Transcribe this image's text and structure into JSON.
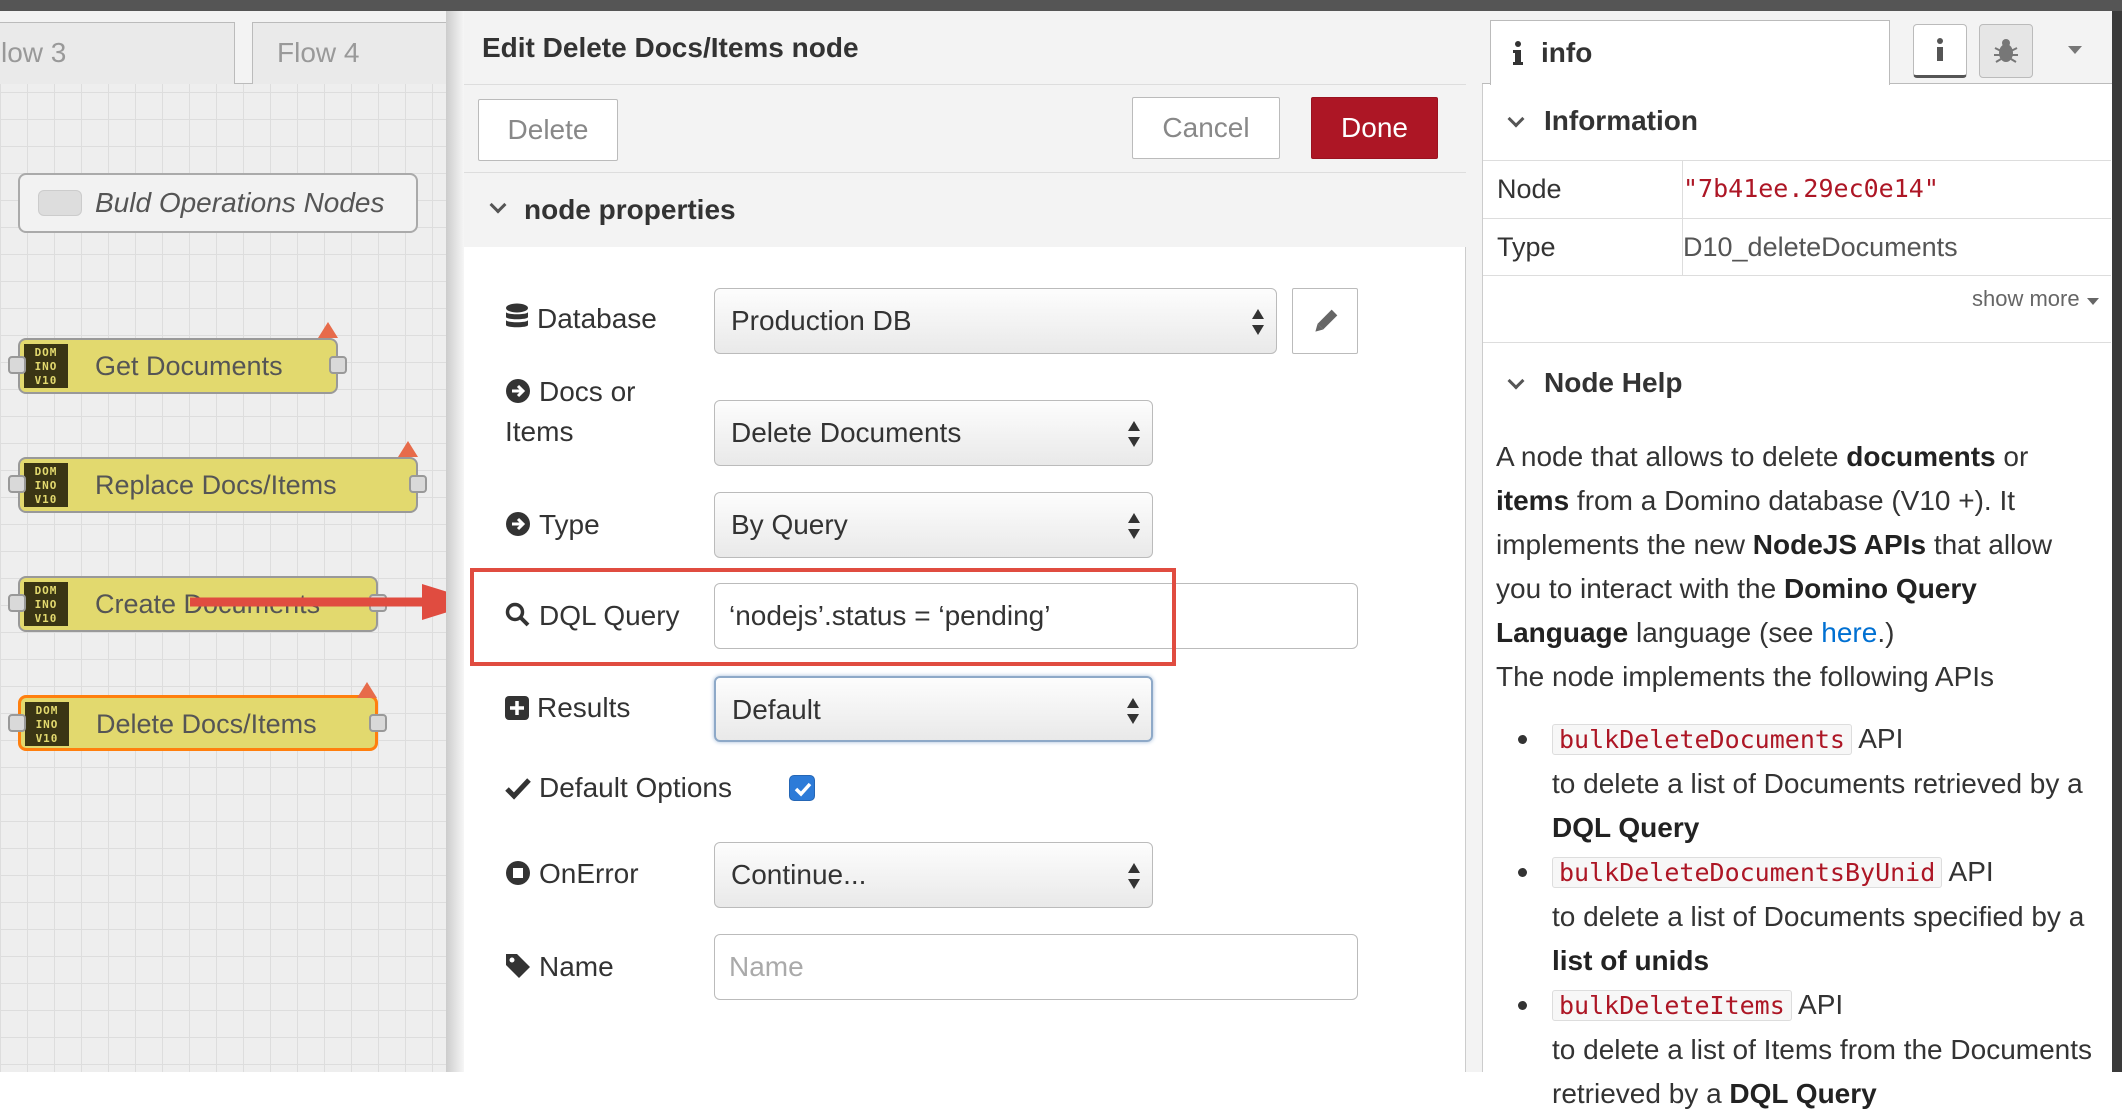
{
  "workspace": {
    "tabs": [
      "low 3",
      "Flow 4"
    ],
    "comment_label": "Buld Operations Nodes",
    "node_icon_text": "DOM\nINO\nV10",
    "nodes": [
      {
        "label": "Get Documents"
      },
      {
        "label": "Replace Docs/Items"
      },
      {
        "label": "Create Documents"
      },
      {
        "label": "Delete Docs/Items"
      }
    ]
  },
  "tray": {
    "title": "Edit Delete Docs/Items node",
    "delete_label": "Delete",
    "cancel_label": "Cancel",
    "done_label": "Done",
    "section_title": "node properties",
    "fields": {
      "database": {
        "label": "Database",
        "value": "Production DB"
      },
      "docs_or_items": {
        "label_line1": "Docs or",
        "label_line2": "Items",
        "value": "Delete Documents"
      },
      "type": {
        "label": "Type",
        "value": "By Query"
      },
      "dql_query": {
        "label": "DQL Query",
        "value": "‘nodejs’.status = ‘pending’"
      },
      "results": {
        "label": "Results",
        "value": "Default"
      },
      "default_options": {
        "label": "Default Options",
        "checked": true
      },
      "on_error": {
        "label": "OnError",
        "value": "Continue..."
      },
      "name": {
        "label": "Name",
        "placeholder": "Name",
        "value": ""
      }
    }
  },
  "sidebar": {
    "tab_label": "info",
    "information_title": "Information",
    "rows": [
      {
        "key": "Node",
        "value": "\"7b41ee.29ec0e14\""
      },
      {
        "key": "Type",
        "value": "D10_deleteDocuments"
      }
    ],
    "show_more": "show more",
    "help_title": "Node Help",
    "help": {
      "p1_a": "A node that allows to delete ",
      "p1_b": "documents",
      "p1_c": " or ",
      "p1_d": "items",
      "p1_e": " from a Domino database (V10 +). It implements the new ",
      "p1_f": "NodeJS APIs",
      "p1_g": " that allow you to interact with the ",
      "p1_h": "Domino Query Language",
      "p1_i": " language (see ",
      "p1_link": "here",
      "p1_j": ".)",
      "p2": "The node implements the following APIs",
      "apis": [
        {
          "code": "bulkDeleteDocuments",
          "suffix": " API",
          "desc": "to delete a list of Documents retrieved by a ",
          "bold": "DQL Query"
        },
        {
          "code": "bulkDeleteDocumentsByUnid",
          "suffix": " API",
          "desc": "to delete a list of Documents specified by a ",
          "bold": "list of unids"
        },
        {
          "code": "bulkDeleteItems",
          "suffix": " API",
          "desc": "to delete a list of Items from the Documents retrieved by a ",
          "bold": "DQL Query"
        }
      ]
    }
  },
  "colors": {
    "done_button": "#ad1625",
    "node_fill": "#e2d96e",
    "selected_node_border": "#ff7f0e",
    "highlight": "#e04c40",
    "checkbox": "#2d7bd8"
  }
}
